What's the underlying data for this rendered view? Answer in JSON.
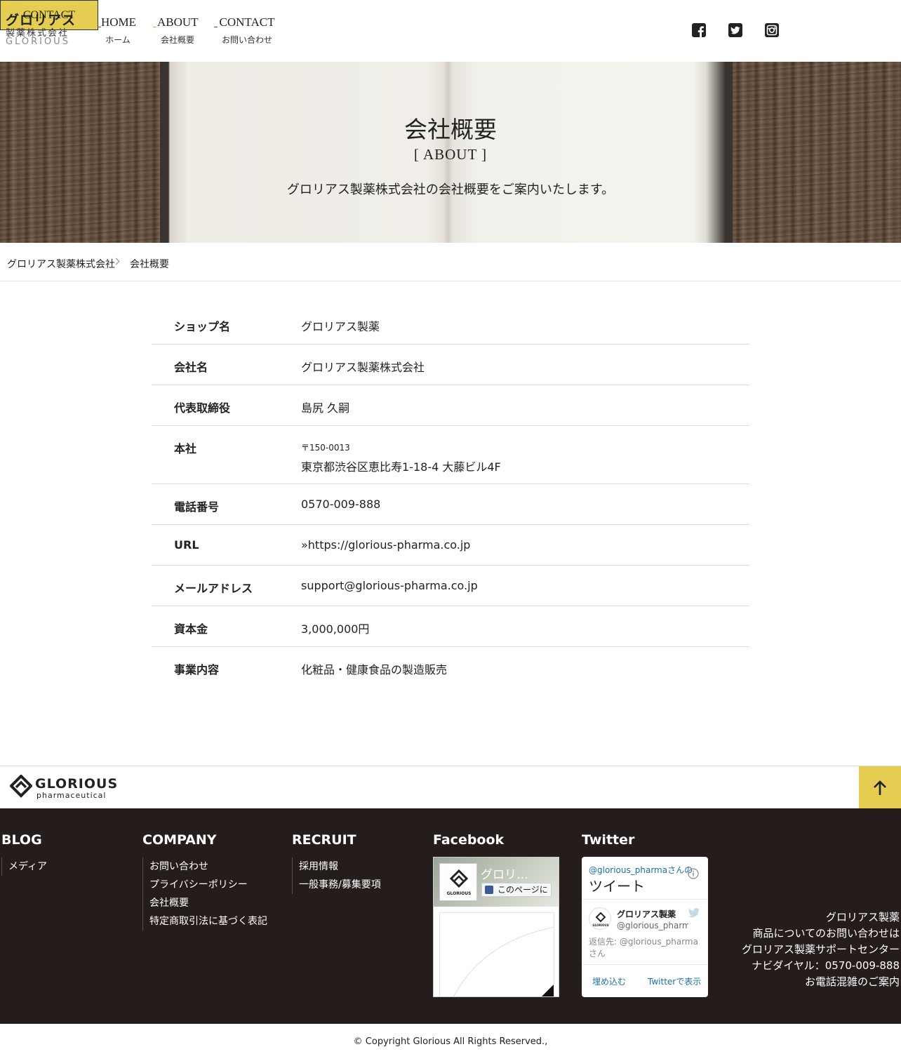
{
  "header": {
    "logo_jp": "グロリアス",
    "logo_jp2": "製薬株式会社",
    "logo_en": "GLORIOUS",
    "nav": [
      {
        "en": "HOME",
        "jp": "ホーム"
      },
      {
        "en": "ABOUT",
        "jp": "会社概要"
      },
      {
        "en": "CONTACT",
        "jp": "お問い合わせ"
      }
    ],
    "social_icons": [
      "facebook-icon",
      "twitter-icon",
      "instagram-icon"
    ],
    "cta_label": "CONTACT",
    "accent_color": "#e5cd52"
  },
  "hero": {
    "title": "会社概要",
    "subtitle": "[ ABOUT ]",
    "description": "グロリアス製薬株式会社の会社概要をご案内いたします。"
  },
  "breadcrumb": {
    "home": "グロリアス製薬株式会社",
    "current": "会社概要"
  },
  "company_info": [
    {
      "label": "ショップ名",
      "value": "グロリアス製薬"
    },
    {
      "label": "会社名",
      "value": "グロリアス製薬株式会社"
    },
    {
      "label": "代表取締役",
      "value": "島尻 久嗣"
    },
    {
      "label": "本社",
      "postal": "〒150-0013",
      "value": "東京都渋谷区恵比寿1-18-4 大藤ビル4F"
    },
    {
      "label": "電話番号",
      "value": "0570-009-888"
    },
    {
      "label": "URL",
      "value": "»https://glorious-pharma.co.jp"
    },
    {
      "label": "メールアドレス",
      "value": "support@glorious-pharma.co.jp"
    },
    {
      "label": "資本金",
      "value": "3,000,000円"
    },
    {
      "label": "事業内容",
      "value": "化粧品・健康食品の製造販売"
    }
  ],
  "footer": {
    "logo_text": "GLORIOUS",
    "logo_sub": "pharmaceutical",
    "columns": [
      {
        "heading": "BLOG",
        "items": [
          "メディア"
        ]
      },
      {
        "heading": "COMPANY",
        "items": [
          "お問い合わせ",
          "プライバシーポリシー",
          "会社概要",
          "特定商取引法に基づく表記"
        ]
      },
      {
        "heading": "RECRUIT",
        "items": [
          "採用情報",
          "一般事務/募集要項"
        ]
      }
    ],
    "facebook": {
      "heading": "Facebook",
      "page_name": "グロリ…",
      "like_label": "このページに"
    },
    "twitter": {
      "heading": "Twitter",
      "handle_line": "@glorious_pharmaさんの",
      "tweets_label": "ツイート",
      "account_name": "グロリアス製薬",
      "account_handle": "@glorious_pharma",
      "reply_text": "返信先: @glorious_pharmaさん",
      "embed_label": "埋め込む",
      "view_label": "Twitterで表示"
    },
    "address_lines": [
      "グロリアス製薬",
      "商品についてのお問い合わせは",
      "グロリアス製薬サポートセンター",
      "ナビダイヤル：0570-009-888",
      "お電話混雑のご案内"
    ],
    "copyright": "© Copyright Glorious All Rights Reserved.,"
  }
}
